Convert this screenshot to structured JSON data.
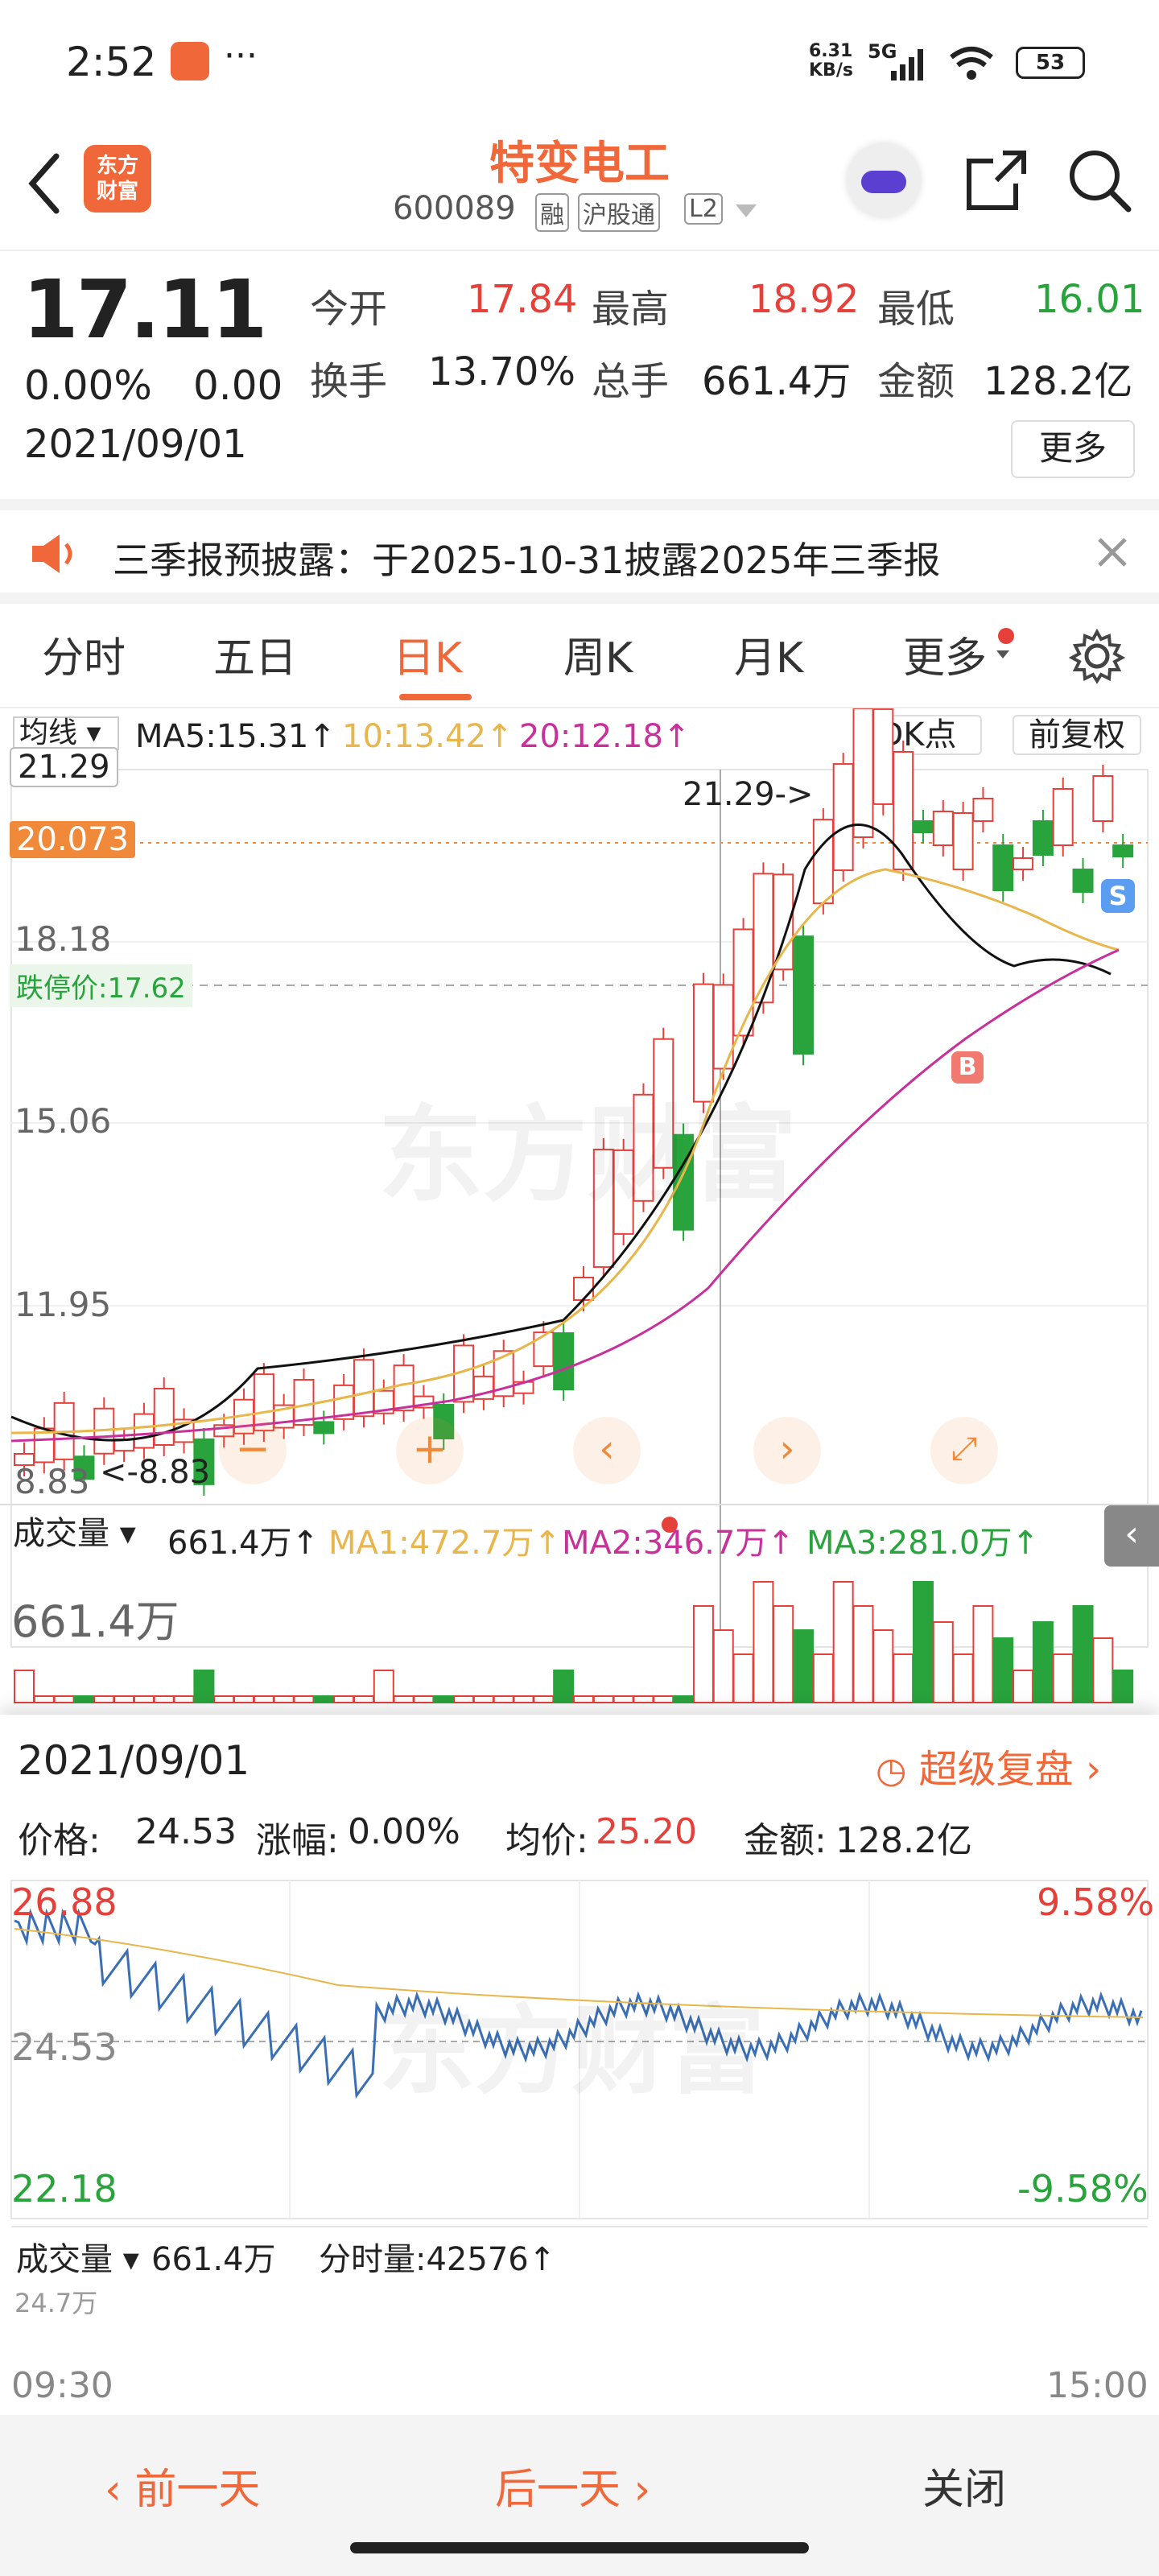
{
  "status_bar": {
    "time": "2:52",
    "network_speed": "6.31\nKB/s",
    "signal": "5G",
    "battery": "53"
  },
  "header": {
    "title": "特变电工",
    "code": "600089",
    "tags": [
      "融",
      "沪股通",
      "L2"
    ],
    "logo_text": "东方\n财富"
  },
  "quote": {
    "price": "17.11",
    "change_pct": "0.00%",
    "change": "0.00",
    "date": "2021/09/01",
    "open_label": "今开",
    "open": "17.84",
    "high_label": "最高",
    "high": "18.92",
    "low_label": "最低",
    "low": "16.01",
    "turnover_label": "换手",
    "turnover": "13.70%",
    "volume_label": "总手",
    "volume": "661.4万",
    "amount_label": "金额",
    "amount": "128.2亿",
    "more_label": "更多"
  },
  "notice": {
    "text": "三季报预披露：于2025-10-31披露2025年三季报"
  },
  "tabs": [
    "分时",
    "五日",
    "日K",
    "周K",
    "月K",
    "更多"
  ],
  "active_tab": 2,
  "kline": {
    "indicator_label": "均线",
    "ma5": "MA5:15.31↑",
    "ma10": "10:13.42↑",
    "ma20": "20:12.18↑",
    "dk_label": "DK点",
    "rights_label": "前复权",
    "price_top": "21.29",
    "price_marker": "20.073",
    "axis": [
      "18.18",
      "15.06",
      "11.95",
      "8.83"
    ],
    "limit_down_label": "跌停价:17.62",
    "high_annotation": "21.29->",
    "low_annotation": "<-8.83",
    "vol_label": "成交量",
    "vol_value": "661.4万↑",
    "vol_ma1": "MA1:472.7万↑",
    "vol_ma2": "MA2:346.7万↑",
    "vol_ma3": "MA3:281.0万↑",
    "vol_axis": "661.4万",
    "watermark": "东方财富",
    "sell_marker": "S",
    "buy_marker": "B"
  },
  "panel": {
    "date": "2021/09/01",
    "replay_label": "超级复盘",
    "price_label": "价格:",
    "price": "24.53",
    "chg_label": "涨幅:",
    "chg": "0.00%",
    "avg_label": "均价:",
    "avg": "25.20",
    "amount_label": "金额:",
    "amount": "128.2亿",
    "axis_top": "26.88",
    "axis_mid": "24.53",
    "axis_bottom": "22.18",
    "pct_top": "9.58%",
    "pct_bottom": "-9.58%",
    "vol_label": "成交量",
    "vol_value": "661.4万",
    "min_vol": "分时量:42576↑",
    "vol_axis": "24.7万",
    "time_start": "09:30",
    "time_end": "15:00"
  },
  "bottom": {
    "prev_label": "前一天",
    "next_label": "后一天",
    "close_label": "关闭"
  },
  "colors": {
    "up": "#e5403a",
    "down": "#29a33c",
    "accent": "#f0893a",
    "ma5": "#111111",
    "ma10": "#e8b64a",
    "ma20": "#c8309a"
  }
}
